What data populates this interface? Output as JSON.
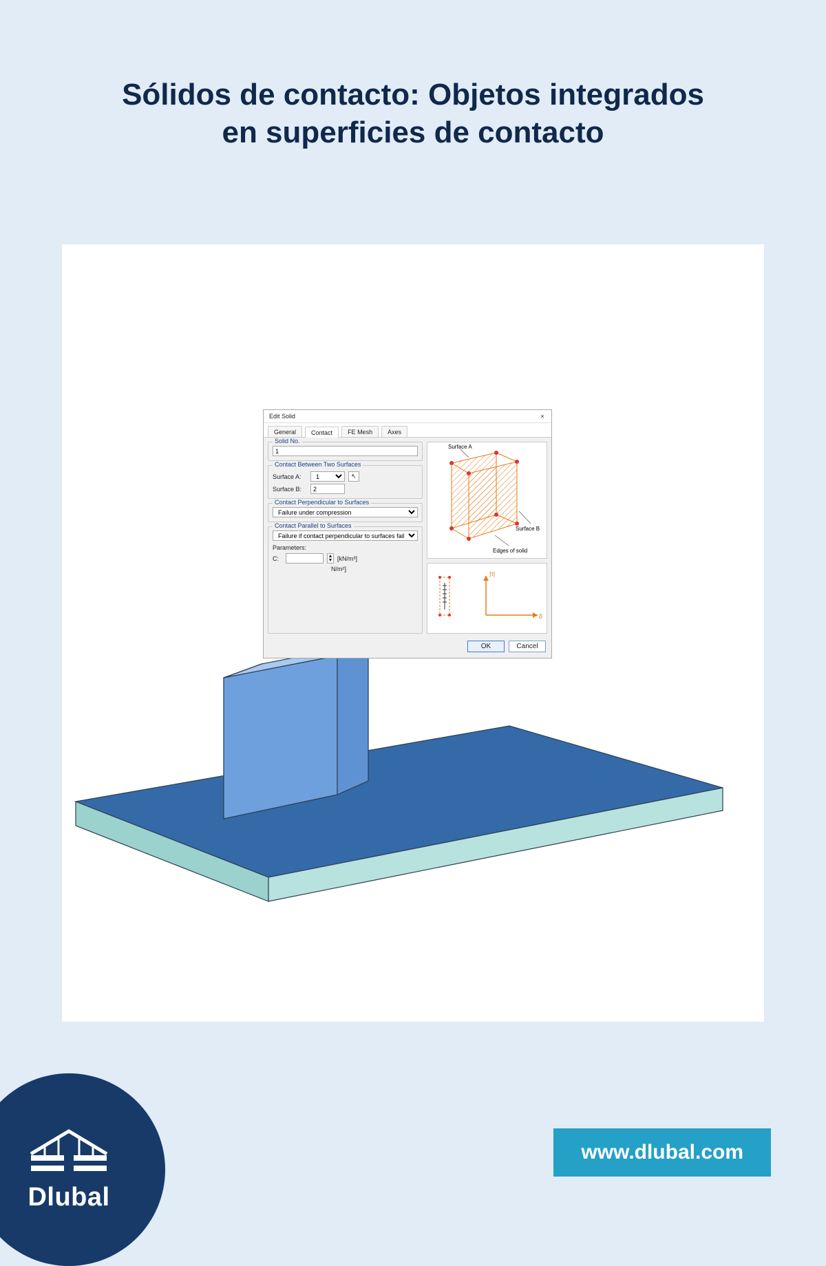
{
  "headline": {
    "line1": "Sólidos de contacto: Objetos integrados",
    "line2": "en superficies de contacto"
  },
  "dialog": {
    "title": "Edit Solid",
    "close_glyph": "×",
    "tabs": {
      "general": "General",
      "contact": "Contact",
      "femesh": "FE Mesh",
      "axes": "Axes"
    },
    "groups": {
      "solid_no": {
        "legend": "Solid No.",
        "value": "1"
      },
      "between": {
        "legend": "Contact Between Two Surfaces",
        "label_a": "Surface A:",
        "value_a": "1",
        "label_b": "Surface B:",
        "value_b": "2",
        "picker_glyph": "↖"
      },
      "perp": {
        "legend": "Contact Perpendicular to Surfaces",
        "option": "Failure under compression"
      },
      "para": {
        "legend": "Contact Parallel to Surfaces",
        "option": "Failure if contact perpendicular to surfaces failed",
        "params_label": "Parameters:",
        "row_c_label": "C:",
        "row_c_value": "",
        "unit1": "[kN/m³]",
        "unit2": "N/m²]"
      }
    },
    "illus": {
      "surface_a": "Surface A",
      "surface_b": "Surface B",
      "edges": "Edges of solid",
      "tau": "|τ|",
      "delta": "δ"
    },
    "buttons": {
      "ok": "OK",
      "cancel": "Cancel"
    }
  },
  "footer": {
    "brand": "Dlubal",
    "url": "www.dlubal.com"
  }
}
